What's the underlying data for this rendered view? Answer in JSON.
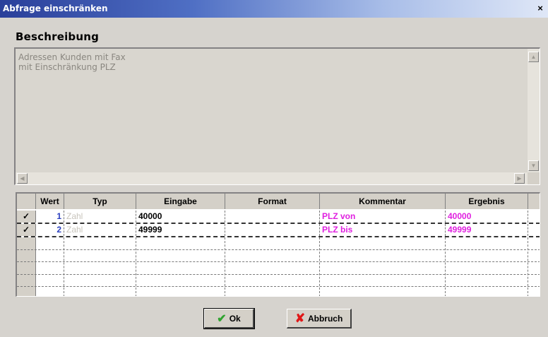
{
  "window": {
    "title": "Abfrage einschränken",
    "close_glyph": "×"
  },
  "description": {
    "label": "Beschreibung",
    "text": "Adressen Kunden mit Fax\nmit Einschränkung PLZ"
  },
  "grid": {
    "columns": [
      "Wert",
      "Typ",
      "Eingabe",
      "Format",
      "Kommentar",
      "Ergebnis"
    ],
    "rows": [
      {
        "checked": "✓",
        "wert": "1",
        "typ": "Zahl",
        "eingabe": "40000",
        "format": "",
        "kommentar": "PLZ von",
        "ergebnis": "40000"
      },
      {
        "checked": "✓",
        "wert": "2",
        "typ": "Zahl",
        "eingabe": "49999",
        "format": "",
        "kommentar": "PLZ bis",
        "ergebnis": "49999"
      }
    ]
  },
  "buttons": {
    "ok": "Ok",
    "cancel": "Abbruch"
  },
  "icons": {
    "ok": "checkmark-icon",
    "cancel": "x-icon",
    "color_ok": "#2fa32f",
    "color_cancel": "#e01818"
  },
  "colors": {
    "title_start": "#2a3f9a",
    "pink_text": "#e020e0",
    "blue_text": "#2a3fbf"
  }
}
